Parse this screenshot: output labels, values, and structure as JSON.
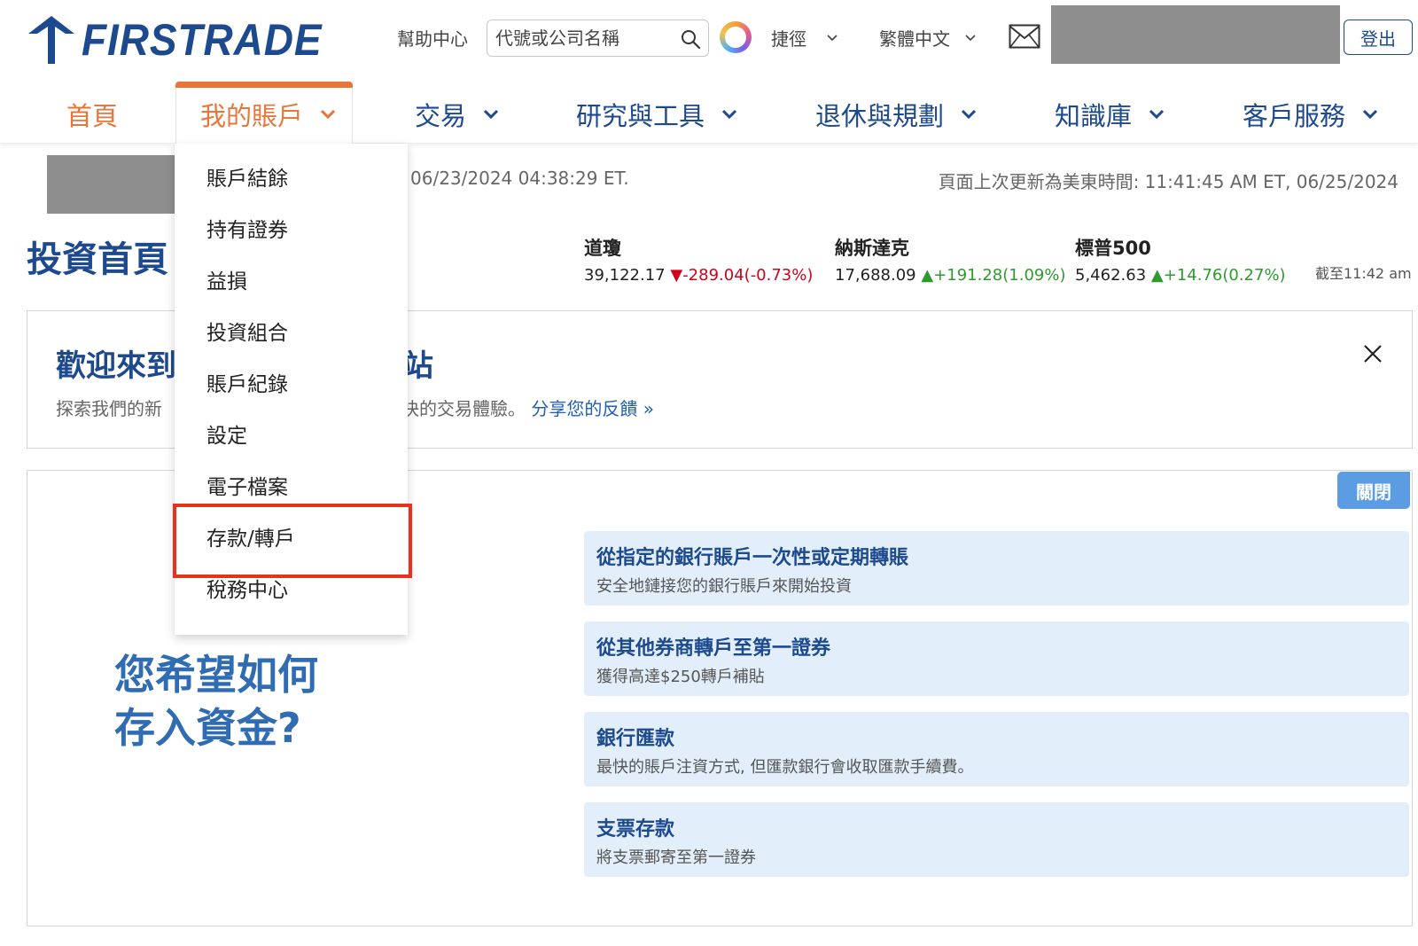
{
  "header": {
    "logo_text": "FIRSTRADE",
    "help_label": "幫助中心",
    "search": {
      "placeholder": "代號或公司名稱",
      "value": ""
    },
    "shortcuts_label": "捷徑",
    "language_label": "繁體中文",
    "logout_label": "登出"
  },
  "nav": {
    "items": [
      {
        "label": "首頁"
      },
      {
        "label": "我的賬戶"
      },
      {
        "label": "交易"
      },
      {
        "label": "研究與工具"
      },
      {
        "label": "退休與規劃"
      },
      {
        "label": "知識庫"
      },
      {
        "label": "客戶服務"
      }
    ],
    "active_item": "我的賬戶"
  },
  "account_menu": {
    "items": [
      {
        "label": "賬戶結餘"
      },
      {
        "label": "持有證券"
      },
      {
        "label": "益損"
      },
      {
        "label": "投資組合"
      },
      {
        "label": "賬戶紀錄"
      },
      {
        "label": "設定"
      },
      {
        "label": "電子檔案"
      },
      {
        "label": "存款/轉戶"
      },
      {
        "label": "稅務中心"
      }
    ],
    "highlighted": "存款/轉戶"
  },
  "info": {
    "last_login": "06/23/2024 04:38:29 ET.",
    "last_update": "頁面上次更新為美東時間: 11:41:45 AM ET, 06/25/2024"
  },
  "page_title": "投資首頁",
  "market": {
    "indices": [
      {
        "name": "道瓊",
        "value": "39,122.17",
        "change": "-289.04(-0.73%)",
        "direction": "down"
      },
      {
        "name": "納斯達克",
        "value": "17,688.09",
        "change": "+191.28(1.09%)",
        "direction": "up"
      },
      {
        "name": "標普500",
        "value": "5,462.63",
        "change": "+14.76(0.27%)",
        "direction": "up"
      }
    ],
    "as_of": "截至11:42 am",
    "colors": {
      "down": "#d0021b",
      "up": "#2e9a2e"
    }
  },
  "welcome": {
    "title_start": "歡迎來到",
    "title_end": "站",
    "text_start": "探索我們的新",
    "text_end": "更快的交易體驗。",
    "feedback_link": "分享您的反饋 »"
  },
  "deposit": {
    "close_label": "關閉",
    "question_line1": "您希望如何",
    "question_line2": "存入資金?",
    "options": [
      {
        "title": "從指定的銀行賬戶一次性或定期轉賬",
        "desc": "安全地鏈接您的銀行賬戶來開始投資"
      },
      {
        "title": "從其他券商轉戶至第一證券",
        "desc": "獲得高達$250轉戶補貼"
      },
      {
        "title": "銀行匯款",
        "desc": "最快的賬戶注資方式, 但匯款銀行會收取匯款手續費。"
      },
      {
        "title": "支票存款",
        "desc": "將支票郵寄至第一證券"
      }
    ]
  },
  "theme": {
    "brand_blue": "#1d4a8e",
    "accent_orange": "#e8763a",
    "highlight_red": "#e8321e",
    "option_bg": "#e3eefb"
  }
}
